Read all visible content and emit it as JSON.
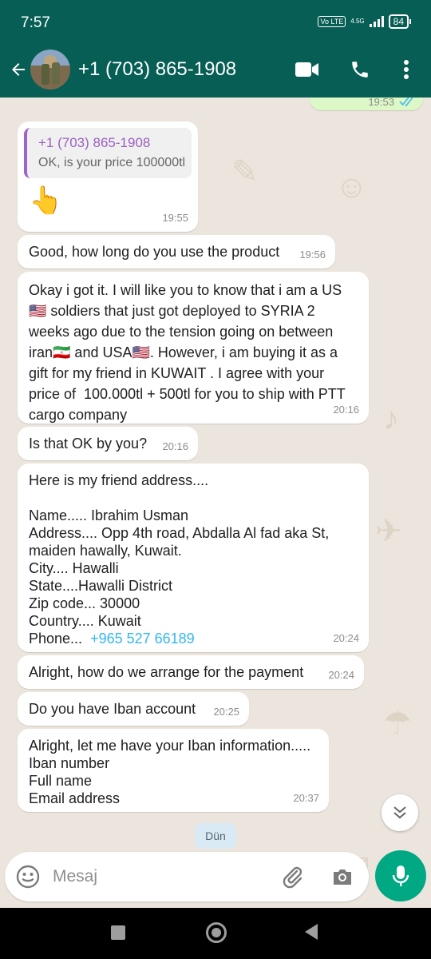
{
  "status_bar": {
    "time": "7:57",
    "volte": "Vo LTE",
    "network": "4.5G",
    "battery": "84"
  },
  "header": {
    "contact_name": "+1 (703) 865-1908"
  },
  "outgoing_partial": {
    "time": "19:53"
  },
  "messages": [
    {
      "type": "reply",
      "quote_name": "+1 (703) 865-1908",
      "quote_text": "OK, is your price 100000tl",
      "text": "👆",
      "time": "19:55"
    },
    {
      "text": "Good, how long do you use the product",
      "time": "19:56"
    },
    {
      "text": "Okay i got it. I will like you to know that i am a US 🇺🇸 soldiers that just got deployed to SYRIA 2 weeks ago due to the tension going on between iran🇮🇷 and USA🇺🇸. However, i am buying it as a gift for my friend in KUWAIT . I agree with your price of  100.000tl + 500tl for you to ship with PTT cargo company",
      "time": "20:16"
    },
    {
      "text": "Is that OK by you?",
      "time": "20:16"
    },
    {
      "text": "Here is my friend address....\n\nName..... Ibrahim Usman\nAddress.... Opp 4th road, Abdalla Al fad aka St, maiden hawally, Kuwait.\nCity.... Hawalli\nState....Hawalli District\nZip code... 30000\nCountry.... Kuwait\nPhone...  ",
      "phone": "+965 527 66189",
      "time": "20:24"
    },
    {
      "text": "Alright, how do we arrange for the payment",
      "time": "20:24"
    },
    {
      "text": "Do you have Iban account",
      "time": "20:25"
    },
    {
      "text": "Alright, let me have your Iban information.....\nIban number\nFull name\nEmail address",
      "time": "20:37"
    }
  ],
  "day_chip": "Dün",
  "composer": {
    "placeholder": "Mesaj"
  },
  "colors": {
    "header": "#075e54",
    "chat_bg": "#ece5dd",
    "mic": "#00a884",
    "outgoing": "#dcf8c6",
    "link": "#34b7f1"
  },
  "icons": [
    "back-arrow-icon",
    "video-call-icon",
    "voice-call-icon",
    "more-options-icon",
    "emoji-icon",
    "attach-icon",
    "camera-icon",
    "mic-icon",
    "chevron-double-down-icon"
  ]
}
